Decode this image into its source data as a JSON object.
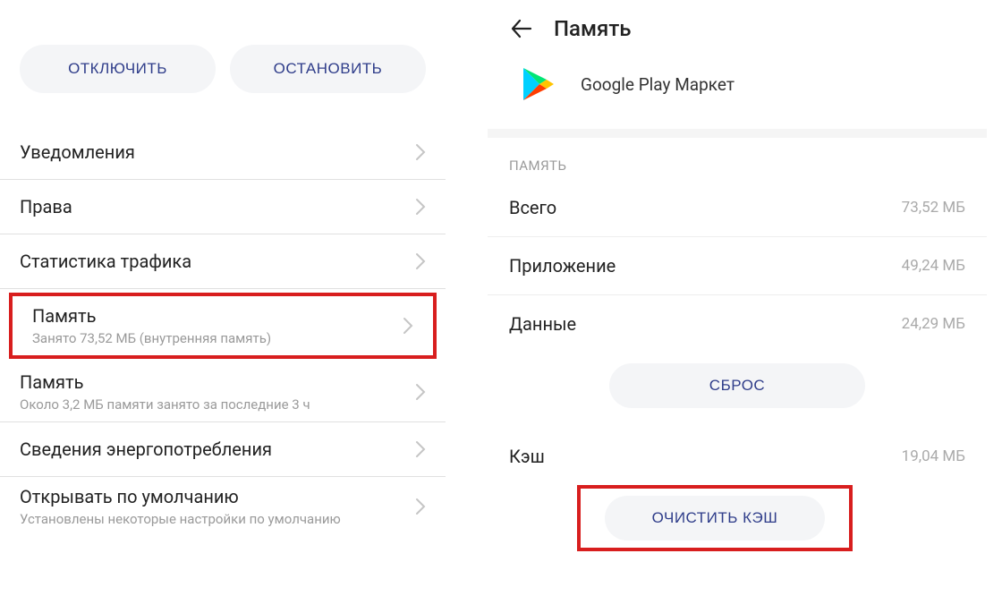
{
  "left": {
    "buttons": {
      "disable": "ОТКЛЮЧИТЬ",
      "stop": "ОСТАНОВИТЬ"
    },
    "rows": {
      "notifications": "Уведомления",
      "permissions": "Права",
      "traffic": "Статистика трафика",
      "memory": {
        "title": "Память",
        "sub": "Занято 73,52 МБ (внутренняя память)"
      },
      "memory2": {
        "title": "Память",
        "sub": "Около 3,2 МБ памяти занято за последние 3 ч"
      },
      "energy": "Сведения энергопотребления",
      "defaults": {
        "title": "Открывать по умолчанию",
        "sub": "Установлены некоторые настройки по умолчанию"
      }
    }
  },
  "right": {
    "title": "Память",
    "app": "Google Play Маркет",
    "section_label": "ПАМЯТЬ",
    "stats": {
      "total": {
        "label": "Всего",
        "value": "73,52 МБ"
      },
      "app": {
        "label": "Приложение",
        "value": "49,24 МБ"
      },
      "data": {
        "label": "Данные",
        "value": "24,29 МБ"
      },
      "cache": {
        "label": "Кэш",
        "value": "19,04 МБ"
      }
    },
    "buttons": {
      "reset": "СБРОС",
      "clear_cache": "ОЧИСТИТЬ КЭШ"
    }
  }
}
